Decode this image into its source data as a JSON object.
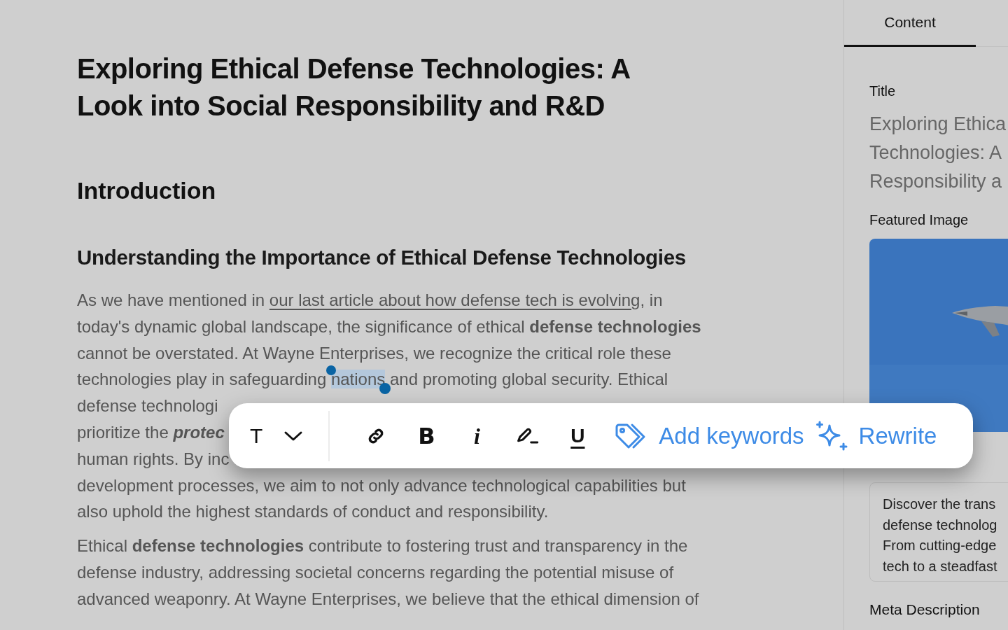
{
  "article": {
    "title": "Exploring Ethical Defense Technologies: A Look into Social Responsibility and R&D",
    "heading": "Introduction",
    "subheading": "Understanding the Importance of Ethical Defense Technologies",
    "paragraphs": [
      {
        "lines": [
          [
            {
              "kind": "plain",
              "text": "As we have mentioned in "
            },
            {
              "kind": "link",
              "text": "our last article about how defense tech is evolving"
            },
            {
              "kind": "plain",
              "text": ", in"
            }
          ],
          [
            {
              "kind": "plain",
              "text": "today's dynamic global landscape, the significance of ethical "
            },
            {
              "kind": "bold",
              "text": "defense technologies"
            }
          ],
          [
            {
              "kind": "plain",
              "text": "cannot be overstated. At Wayne Enterprises, we recognize the critical role these"
            }
          ],
          [
            {
              "kind": "plain",
              "text": "technologies play in safeguarding "
            },
            {
              "kind": "selection",
              "text": "nations"
            },
            {
              "kind": "plain",
              "text": " and promoting global security. Ethical"
            }
          ],
          [
            {
              "kind": "plain",
              "text": "defense technologi"
            }
          ],
          [
            {
              "kind": "plain",
              "text": "prioritize the "
            },
            {
              "kind": "bold_italic",
              "text": "protec"
            }
          ],
          [
            {
              "kind": "plain",
              "text": "human rights. By inc"
            }
          ],
          [
            {
              "kind": "plain",
              "text": "development processes, we aim to not only advance technological capabilities but"
            }
          ],
          [
            {
              "kind": "plain",
              "text": "also uphold the highest standards of conduct and responsibility."
            }
          ]
        ]
      },
      {
        "lines": [
          [
            {
              "kind": "plain",
              "text": "Ethical "
            },
            {
              "kind": "bold",
              "text": "defense technologies"
            },
            {
              "kind": "plain",
              "text": " contribute to fostering trust and transparency in the"
            }
          ],
          [
            {
              "kind": "plain",
              "text": "defense industry, addressing societal concerns regarding the potential misuse of"
            }
          ],
          [
            {
              "kind": "plain",
              "text": "advanced weaponry. At Wayne Enterprises, we believe that the ethical dimension of"
            }
          ]
        ]
      }
    ]
  },
  "toolbar": {
    "items": [
      {
        "kind": "dropdown",
        "glyph": "T"
      },
      {
        "kind": "divider"
      },
      {
        "kind": "link"
      },
      {
        "kind": "bold",
        "glyph": "B"
      },
      {
        "kind": "italic",
        "glyph": "i"
      },
      {
        "kind": "highlight"
      },
      {
        "kind": "underline",
        "glyph": "U"
      },
      {
        "kind": "keywords",
        "label": "Add keywords"
      },
      {
        "kind": "rewrite",
        "label": "Rewrite"
      }
    ]
  },
  "sidebar": {
    "tabs": [
      {
        "label": "Content",
        "selected": true
      }
    ],
    "title_label": "Title",
    "title_lines": [
      "Exploring Ethica",
      "Technologies: A",
      "Responsibility a"
    ],
    "featured_image_label": "Featured Image",
    "featured_image": {
      "kind": "picture"
    },
    "excerpt_lines": [
      "Discover the trans",
      "defense technolog",
      "From cutting-edge",
      "tech to a steadfast"
    ],
    "meta_description_label": "Meta Description"
  }
}
